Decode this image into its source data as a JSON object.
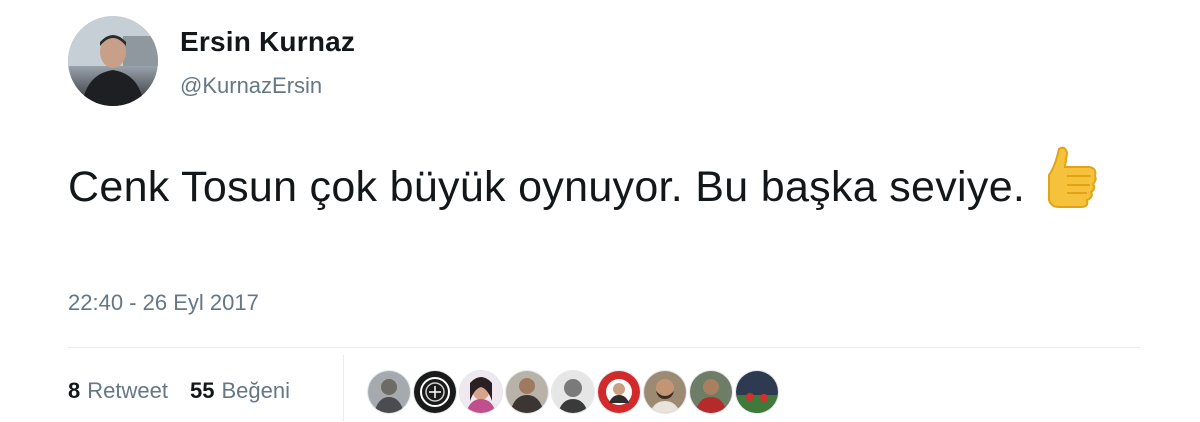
{
  "user": {
    "display_name": "Ersin Kurnaz",
    "handle": "@KurnazErsin"
  },
  "tweet": {
    "text": "Cenk Tosun çok büyük oynuyor. Bu başka seviye.",
    "emoji": "thumbs-up-icon",
    "timestamp": "22:40 - 26 Eyl 2017"
  },
  "stats": {
    "retweet_count": "8",
    "retweet_label": "Retweet",
    "like_count": "55",
    "like_label": "Beğeni"
  },
  "liker_avatars": [
    {
      "icon": "liker-avatar-1",
      "bg": "#8c8f94"
    },
    {
      "icon": "liker-avatar-2",
      "bg": "#1a1a1a"
    },
    {
      "icon": "liker-avatar-3",
      "bg": "#c04f8e"
    },
    {
      "icon": "liker-avatar-4",
      "bg": "#6b6358"
    },
    {
      "icon": "liker-avatar-5",
      "bg": "#d9d9d9"
    },
    {
      "icon": "liker-avatar-6",
      "bg": "#d22a2a"
    },
    {
      "icon": "liker-avatar-7",
      "bg": "#7d6a55"
    },
    {
      "icon": "liker-avatar-8",
      "bg": "#5a6a55"
    },
    {
      "icon": "liker-avatar-9",
      "bg": "#2d3a4f"
    }
  ],
  "colors": {
    "text": "#14171a",
    "secondary": "#657786",
    "divider": "#e6ecf0",
    "emoji": "#f7c23b"
  }
}
